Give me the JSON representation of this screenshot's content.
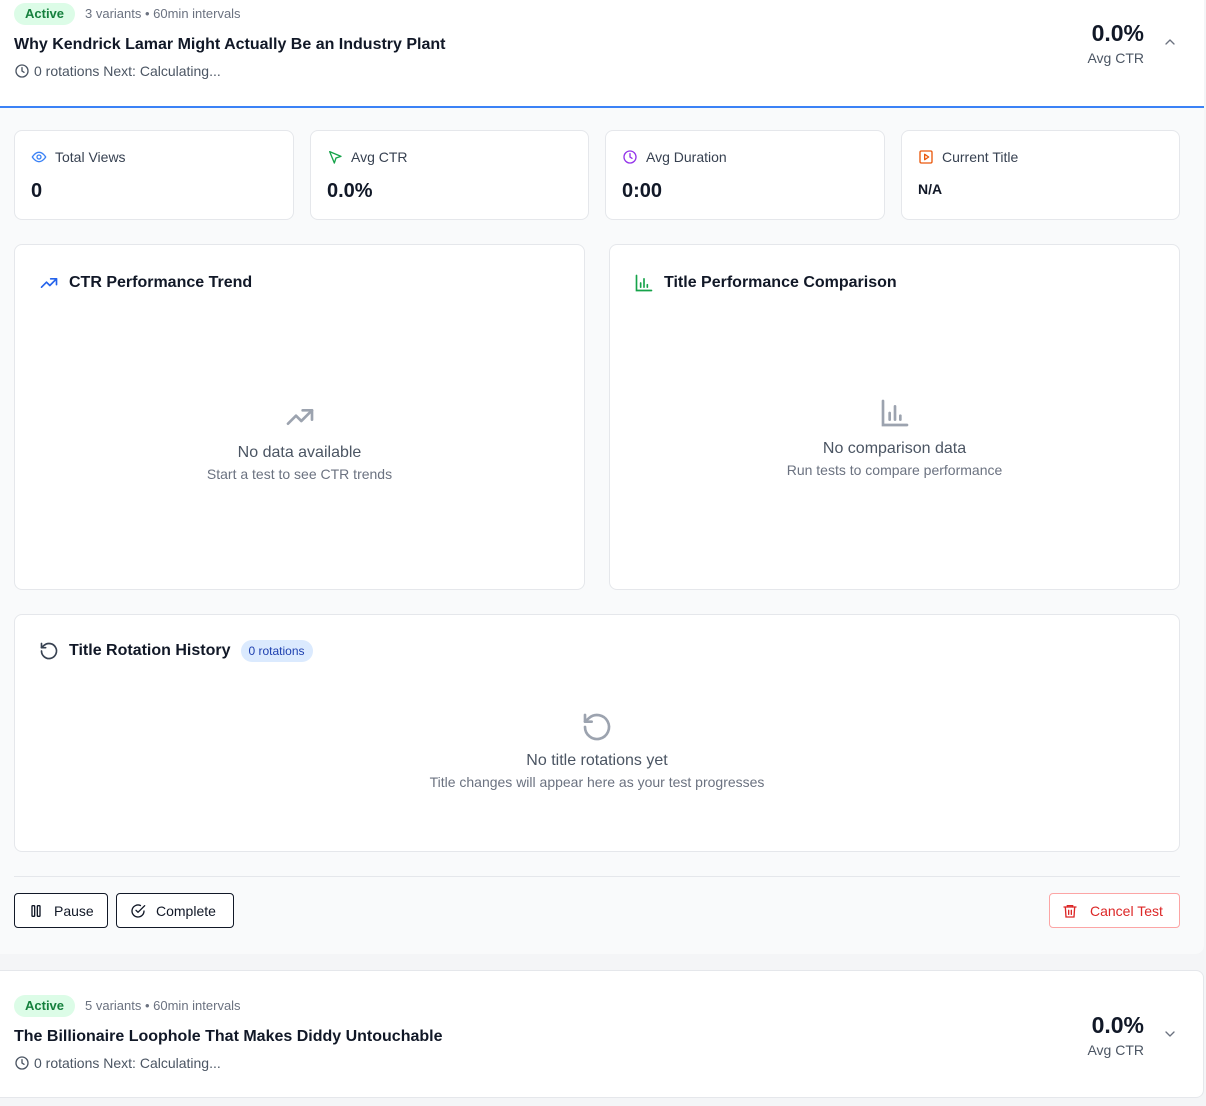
{
  "tests": [
    {
      "status": "Active",
      "meta": "3 variants • 60min intervals",
      "title": "Why Kendrick Lamar Might Actually Be an Industry Plant",
      "subline": "0 rotations Next: Calculating...",
      "avg_ctr": "0.0%",
      "avg_ctr_label": "Avg CTR",
      "expanded": true
    },
    {
      "status": "Active",
      "meta": "5 variants • 60min intervals",
      "title": "The Billionaire Loophole That Makes Diddy Untouchable",
      "subline": "0 rotations Next: Calculating...",
      "avg_ctr": "0.0%",
      "avg_ctr_label": "Avg CTR",
      "expanded": false
    }
  ],
  "stats": [
    {
      "label": "Total Views",
      "value": "0",
      "icon": "eye-icon",
      "color": "#3b82f6"
    },
    {
      "label": "Avg CTR",
      "value": "0.0%",
      "icon": "cursor-icon",
      "color": "#16a34a"
    },
    {
      "label": "Avg Duration",
      "value": "0:00",
      "icon": "clock-icon",
      "color": "#9333ea"
    },
    {
      "label": "Current Title",
      "value": "N/A",
      "icon": "play-icon",
      "color": "#ea580c"
    }
  ],
  "ctr_trend": {
    "title": "CTR Performance Trend",
    "empty_title": "No data available",
    "empty_sub": "Start a test to see CTR trends"
  },
  "comparison": {
    "title": "Title Performance Comparison",
    "empty_title": "No comparison data",
    "empty_sub": "Run tests to compare performance"
  },
  "history": {
    "title": "Title Rotation History",
    "badge": "0 rotations",
    "empty_title": "No title rotations yet",
    "empty_sub": "Title changes will appear here as your test progresses"
  },
  "actions": {
    "pause": "Pause",
    "complete": "Complete",
    "cancel": "Cancel Test"
  },
  "colors": {
    "accent": "#3b82f6",
    "active_badge_bg": "#dcfce7",
    "active_badge_text": "#15803d",
    "danger": "#dc2626"
  }
}
